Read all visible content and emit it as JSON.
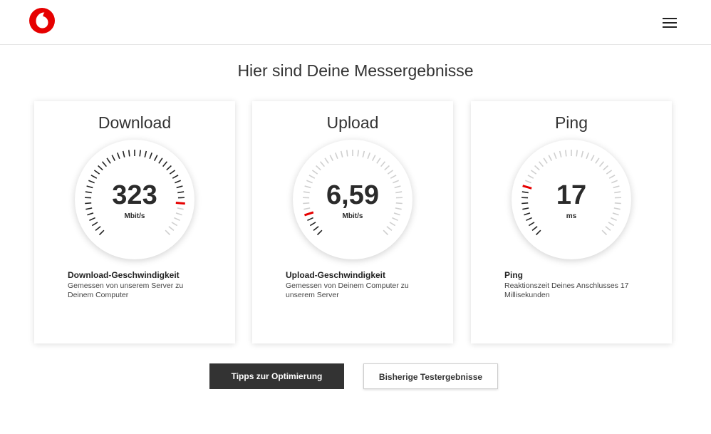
{
  "header": {
    "logo_icon": "vodafone-logo-icon",
    "menu_icon": "hamburger-menu-icon"
  },
  "page": {
    "title": "Hier sind Deine Messergebnisse"
  },
  "panels": [
    {
      "title": "Download",
      "value": "323",
      "unit": "Mbit/s",
      "heading": "Download-Geschwindigkeit",
      "description": "Gemessen von unserem Server zu Deinem Computer",
      "gauge_level": 0.85
    },
    {
      "title": "Upload",
      "value": "6,59",
      "unit": "Mbit/s",
      "heading": "Upload-Geschwindigkeit",
      "description": "Gemessen von Deinem Computer zu unserem Server",
      "gauge_level": 0.1
    },
    {
      "title": "Ping",
      "value": "17",
      "unit": "ms",
      "heading": "Ping",
      "description": "Reaktionszeit Deines Anschlusses 17 Millisekunden",
      "gauge_level": 0.22
    }
  ],
  "buttons": {
    "tips_label": "Tipps zur Optimierung",
    "history_label": "Bisherige Testergebnisse"
  },
  "colors": {
    "brand_red": "#e60000",
    "tick_dark": "#222222",
    "tick_light": "#cfcfcf",
    "button_dark": "#333333"
  }
}
